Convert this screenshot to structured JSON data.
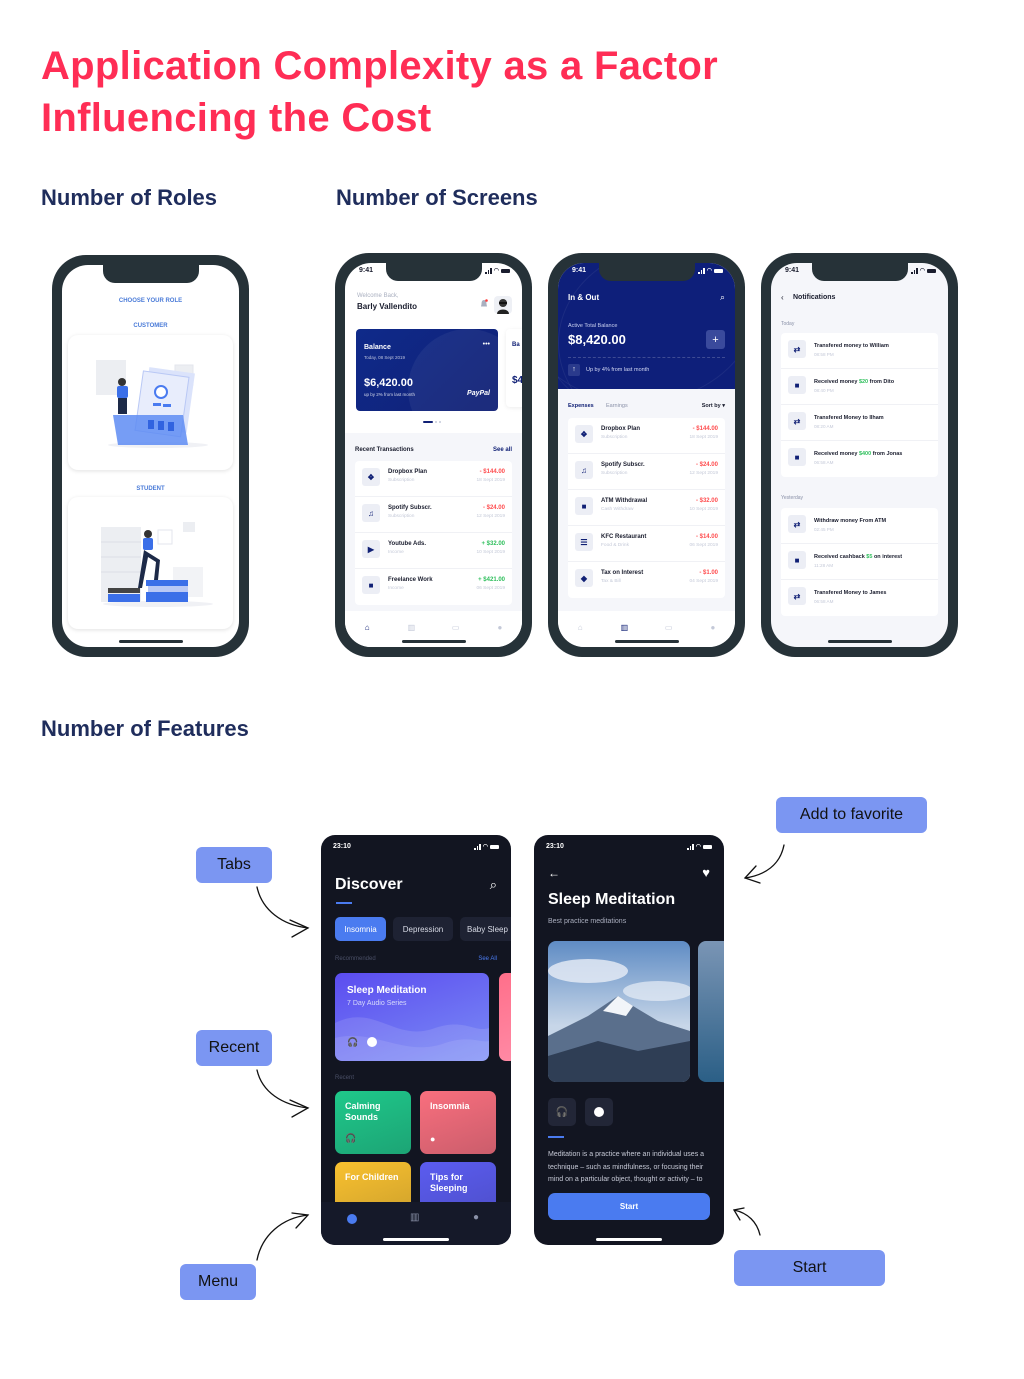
{
  "title": "Application Complexity as a Factor Influencing the Cost",
  "sections": {
    "roles": "Number of Roles",
    "screens": "Number of Screens",
    "features": "Number of Features"
  },
  "colors": {
    "title": "#ff2d55",
    "section": "#1f2d5c",
    "navy": "#102075",
    "label_bg": "#7b96f2",
    "negative": "#ff4d4f",
    "positive": "#2fbf5c",
    "dark_bg": "#121521",
    "accent_blue": "#4a7bf0"
  },
  "roles_screen": {
    "heading": "CHOOSE YOUR ROLE",
    "roles": [
      {
        "label": "CUSTOMER",
        "illustration": "customer-illustration"
      },
      {
        "label": "STUDENT",
        "illustration": "student-illustration"
      }
    ]
  },
  "home_screen": {
    "time": "9:41",
    "welcome": "Welcome Back,",
    "user_name": "Barly Vallendito",
    "balance_card": {
      "title": "Balance",
      "date": "Today, 08 Sept 2019",
      "amount": "$6,420.00",
      "change": "up by 2% from last month",
      "brand": "PayPal",
      "menu": "•••"
    },
    "peek_card": {
      "title": "Ba",
      "sub": "Tod",
      "amount": "$4",
      "change": "Dov"
    },
    "recent_title": "Recent Transactions",
    "see_all": "See all",
    "transactions": [
      {
        "icon": "dropbox-icon",
        "glyph": "❖",
        "name": "Dropbox Plan",
        "sub": "Subscription",
        "amount": "- $144.00",
        "date": "18 Sept 2019",
        "type": "neg"
      },
      {
        "icon": "music-icon",
        "glyph": "♫",
        "name": "Spotify Subscr.",
        "sub": "Subscription",
        "amount": "- $24.00",
        "date": "12 Sept 2019",
        "type": "neg"
      },
      {
        "icon": "youtube-icon",
        "glyph": "▶",
        "name": "Youtube Ads.",
        "sub": "Income",
        "amount": "+ $32.00",
        "date": "10 Sept 2019",
        "type": "pos"
      },
      {
        "icon": "briefcase-icon",
        "glyph": "■",
        "name": "Freelance Work",
        "sub": "Income",
        "amount": "+ $421.00",
        "date": "06 Sept 2019",
        "type": "pos"
      }
    ]
  },
  "inout_screen": {
    "time": "9:41",
    "title": "In & Out",
    "balance_label": "Active Total Balance",
    "balance": "$8,420.00",
    "add": "+",
    "change": "Up by 4% from last month",
    "tabs": [
      "Expenses",
      "Earnings"
    ],
    "sort": "Sort by",
    "transactions": [
      {
        "icon": "dropbox-icon",
        "glyph": "❖",
        "name": "Dropbox Plan",
        "sub": "Subscription",
        "amount": "- $144.00",
        "date": "18 Sept 2019"
      },
      {
        "icon": "music-icon",
        "glyph": "♫",
        "name": "Spotify Subscr.",
        "sub": "Subscription",
        "amount": "- $24.00",
        "date": "12 Sept 2019"
      },
      {
        "icon": "wallet-icon",
        "glyph": "■",
        "name": "ATM Withdrawal",
        "sub": "Cash Withdraw",
        "amount": "- $32.00",
        "date": "10 Sept 2019"
      },
      {
        "icon": "food-icon",
        "glyph": "☰",
        "name": "KFC Restaurant",
        "sub": "Food & Drink",
        "amount": "- $14.00",
        "date": "06 Sept 2019"
      },
      {
        "icon": "leaf-icon",
        "glyph": "◆",
        "name": "Tax on Interest",
        "sub": "Tax & Bill",
        "amount": "- $1.00",
        "date": "04 Sept 2019"
      }
    ]
  },
  "notifications_screen": {
    "time": "9:41",
    "title": "Notifications",
    "groups": [
      {
        "label": "Today",
        "items": [
          {
            "icon": "transfer-icon",
            "pre": "Transfered money to William",
            "amount": "",
            "post": "",
            "time": "08:58 PM"
          },
          {
            "icon": "wallet-icon",
            "pre": "Received money ",
            "amount": "$20",
            "post": " from Dito",
            "time": "08:40 PM"
          },
          {
            "icon": "transfer-icon",
            "pre": "Transfered Money to Ilham",
            "amount": "",
            "post": "",
            "time": "08:20 AM"
          },
          {
            "icon": "wallet-icon",
            "pre": "Received money ",
            "amount": "$400",
            "post": " from Jonas",
            "time": "06:58 AM"
          }
        ]
      },
      {
        "label": "Yesterday",
        "items": [
          {
            "icon": "transfer-icon",
            "pre": "Withdraw money From ATM",
            "amount": "",
            "post": "",
            "time": "02:45 PM"
          },
          {
            "icon": "wallet-icon",
            "pre": "Received cashback ",
            "amount": "$5",
            "post": " on interest",
            "time": "11:28 AM"
          },
          {
            "icon": "transfer-icon",
            "pre": "Transfered Money to James",
            "amount": "",
            "post": "",
            "time": "06:58 AM"
          }
        ]
      }
    ]
  },
  "discover_screen": {
    "time": "23:10",
    "title": "Discover",
    "chips": [
      "Insomnia",
      "Depression",
      "Baby Sleep"
    ],
    "recommended_label": "Recommended",
    "see_all": "See All",
    "featured": {
      "title": "Sleep Meditation",
      "subtitle": "7 Day Audio Series"
    },
    "recent_label": "Recent",
    "recent": [
      {
        "title": "Calming Sounds",
        "icon": "headphones-icon",
        "color": "#1fc88a"
      },
      {
        "title": "Insomnia",
        "icon": "film-reel-icon",
        "color": "#f96f7e"
      },
      {
        "title": "For Children",
        "icon": "",
        "color": "#f9c12f"
      },
      {
        "title": "Tips for Sleeping",
        "icon": "",
        "color": "#5b5cf0"
      }
    ]
  },
  "detail_screen": {
    "time": "23:10",
    "title": "Sleep Meditation",
    "subtitle": "Best practice meditations",
    "description": "Meditation is a practice where an individual uses a technique – such as mindfulness, or focusing their mind on a particular object, thought or activity – to train attention and",
    "start": "Start"
  },
  "annotations": {
    "tabs": "Tabs",
    "recent": "Recent",
    "menu": "Menu",
    "favorite": "Add to favorite",
    "start": "Start"
  }
}
